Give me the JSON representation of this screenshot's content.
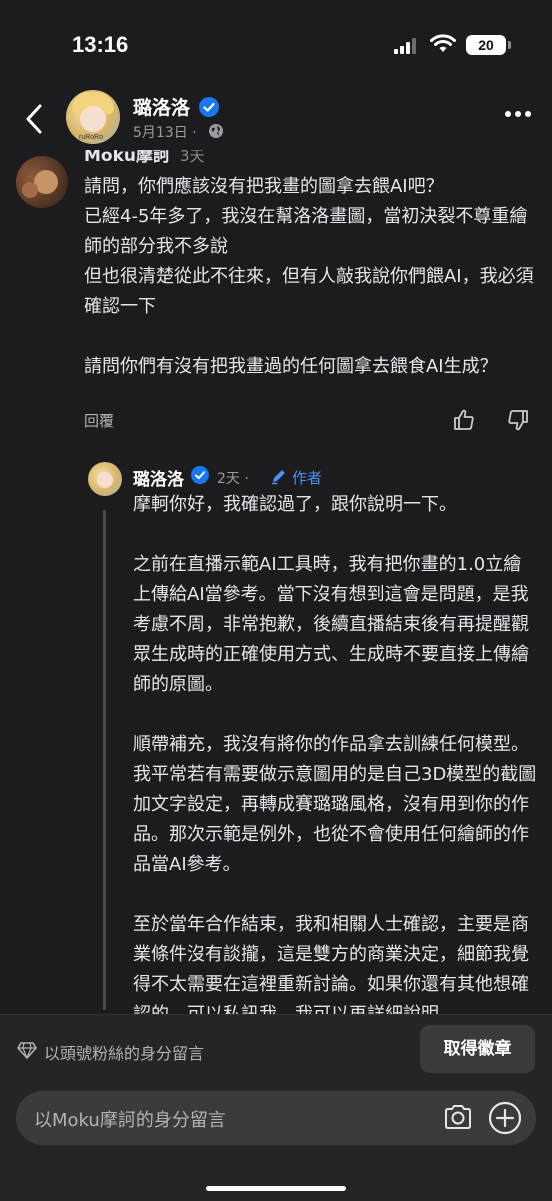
{
  "status_bar": {
    "time": "13:16",
    "battery": "20"
  },
  "post_header": {
    "author": "璐洛洛",
    "date": "5月13日 ·",
    "avatar_tag": "ruRoRo",
    "icons": {
      "back": "chevron-left-icon",
      "verified": "verified-badge-icon",
      "visibility": "globe-icon",
      "more": "more-horizontal-icon"
    }
  },
  "comment": {
    "author": "Moku摩訶",
    "time": "3天",
    "text": "請問，你們應該沒有把我畫的圖拿去餵AI吧？\n已經4-5年多了，我沒在幫洛洛畫圖，當初決裂不尊重繪師的部分我不多說\n但也很清楚從此不往來，但有人敲我說你們餵AI，我必須確認一下\n\n請問你們有沒有把我畫過的任何圖拿去餵食AI生成？",
    "reply_label": "回覆",
    "icons": {
      "like": "thumbs-up-icon",
      "dislike": "thumbs-down-icon"
    }
  },
  "reply": {
    "author": "璐洛洛",
    "time": "2天 ·",
    "author_badge": "作者",
    "text": "摩軻你好，我確認過了，跟你說明一下。\n\n之前在直播示範AI工具時，我有把你畫的1.0立繪上傳給AI當參考。當下沒有想到這會是問題，是我考慮不周，非常抱歉，後續直播結束後有再提醒觀眾生成時的正確使用方式、生成時不要直接上傳繪師的原圖。\n\n順帶補充，我沒有將你的作品拿去訓練任何模型。我平常若有需要做示意圖用的是自己3D模型的截圖加文字設定，再轉成賽璐璐風格，沒有用到你的作品。那次示範是例外，也從不會使用任何繪師的作品當AI參考。\n\n至於當年合作結束，我和相關人士確認，主要是商業條件沒有談攏，這是雙方的商業決定，細節我覺得不太需要在這裡重新討論。如果你還有其他想確認的，可以私訊我，我可以再詳細說明。",
    "icons": {
      "author": "pencil-icon"
    }
  },
  "footer": {
    "fan_label": "以頭號粉絲的身分留言",
    "badge_button": "取得徽章",
    "input_placeholder": "以Moku摩訶的身分留言",
    "icons": {
      "fan": "diamond-icon",
      "camera": "camera-icon",
      "add": "plus-circle-icon"
    }
  },
  "colors": {
    "background": "#1c1c1e",
    "accent": "#4a90f5",
    "verified": "#1877f2"
  }
}
